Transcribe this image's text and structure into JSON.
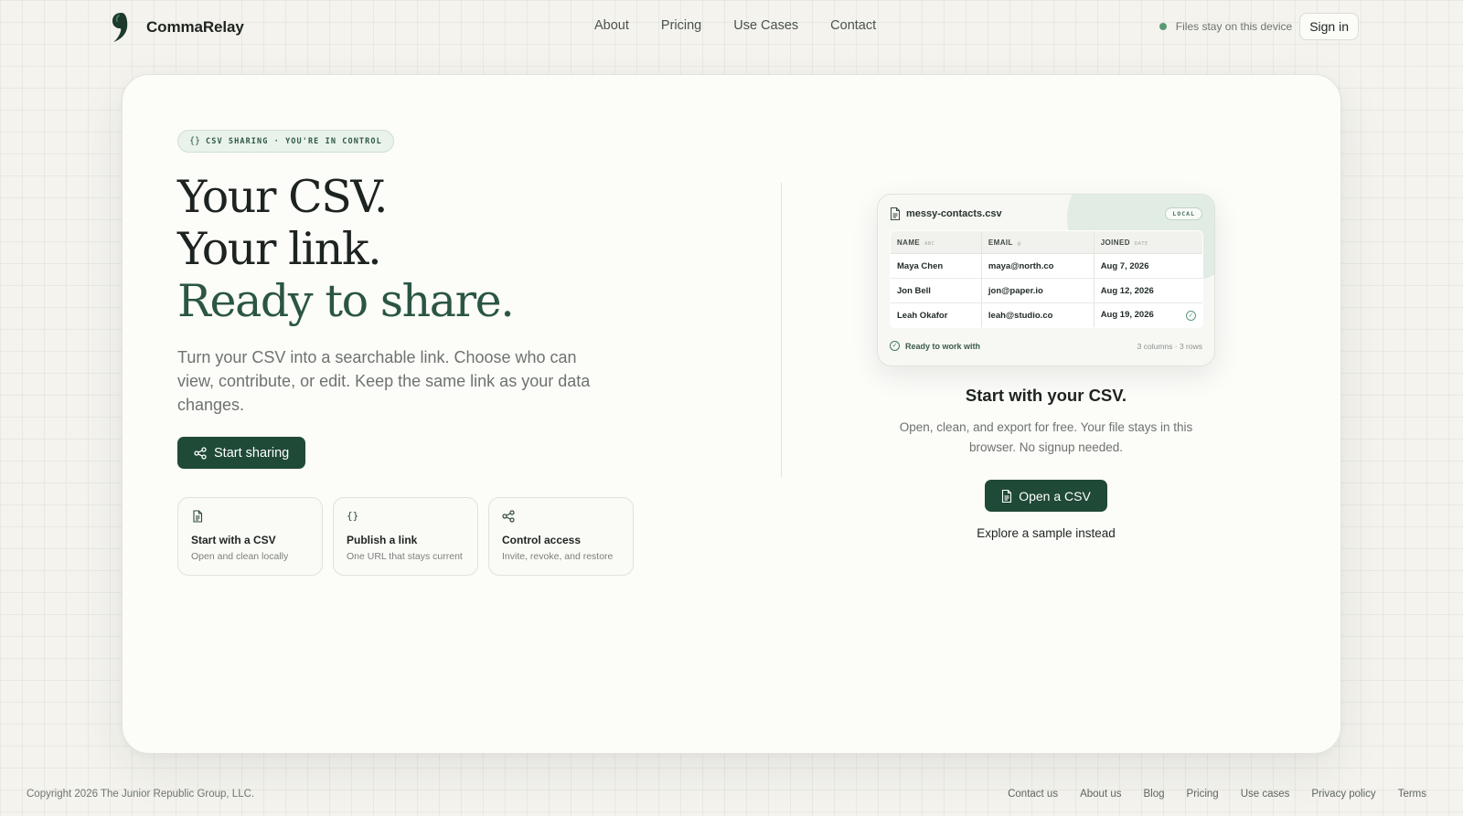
{
  "nav": {
    "brand": "CommaRelay",
    "links": [
      "About",
      "Pricing",
      "Use Cases",
      "Contact"
    ],
    "status_text": "Files stay on this device",
    "signin": "Sign in"
  },
  "hero": {
    "badge_icon": "{}",
    "badge": "CSV sharing · you're in control",
    "title_line1": "Your CSV.",
    "title_line2": "Your link.",
    "title_line3": "Ready to share.",
    "description": "Turn your CSV into a searchable link. Choose who can view, contribute, or edit. Keep the same link as your data changes.",
    "cta": "Start sharing",
    "features": [
      {
        "icon": "file-icon",
        "title": "Start with a CSV",
        "subtitle": "Open and clean locally"
      },
      {
        "icon": "braces-icon",
        "icon_text": "{}",
        "title": "Publish a link",
        "subtitle": "One URL that stays current"
      },
      {
        "icon": "share-icon",
        "title": "Control access",
        "subtitle": "Invite, revoke, and restore"
      }
    ]
  },
  "preview": {
    "file_name": "messy-contacts.csv",
    "badge": "Local",
    "columns": [
      {
        "name": "Name",
        "type": "abc"
      },
      {
        "name": "Email",
        "type": "@"
      },
      {
        "name": "Joined",
        "type": "date"
      }
    ],
    "rows": [
      [
        "Maya Chen",
        "maya@north.co",
        "Aug 7, 2026"
      ],
      [
        "Jon Bell",
        "jon@paper.io",
        "Aug 12, 2026"
      ],
      [
        "Leah Okafor",
        "leah@studio.co",
        "Aug 19, 2026"
      ]
    ],
    "status": "Ready to work with",
    "meta": "3 columns · 3 rows"
  },
  "right": {
    "title": "Start with your CSV.",
    "description": "Open, clean, and export for free. Your file stays in this browser. No signup needed.",
    "open_button": "Open a CSV",
    "sample_link": "Explore a sample instead"
  },
  "footer": {
    "copyright": "Copyright 2026 The Junior Republic Group, LLC.",
    "links": [
      "Contact us",
      "About us",
      "Blog",
      "Pricing",
      "Use cases",
      "Privacy policy",
      "Terms"
    ]
  },
  "colors": {
    "accent": "#1f4a37",
    "accent_text": "#2a5643",
    "status_dot": "#5a9a72",
    "background": "#f4f3ee"
  }
}
